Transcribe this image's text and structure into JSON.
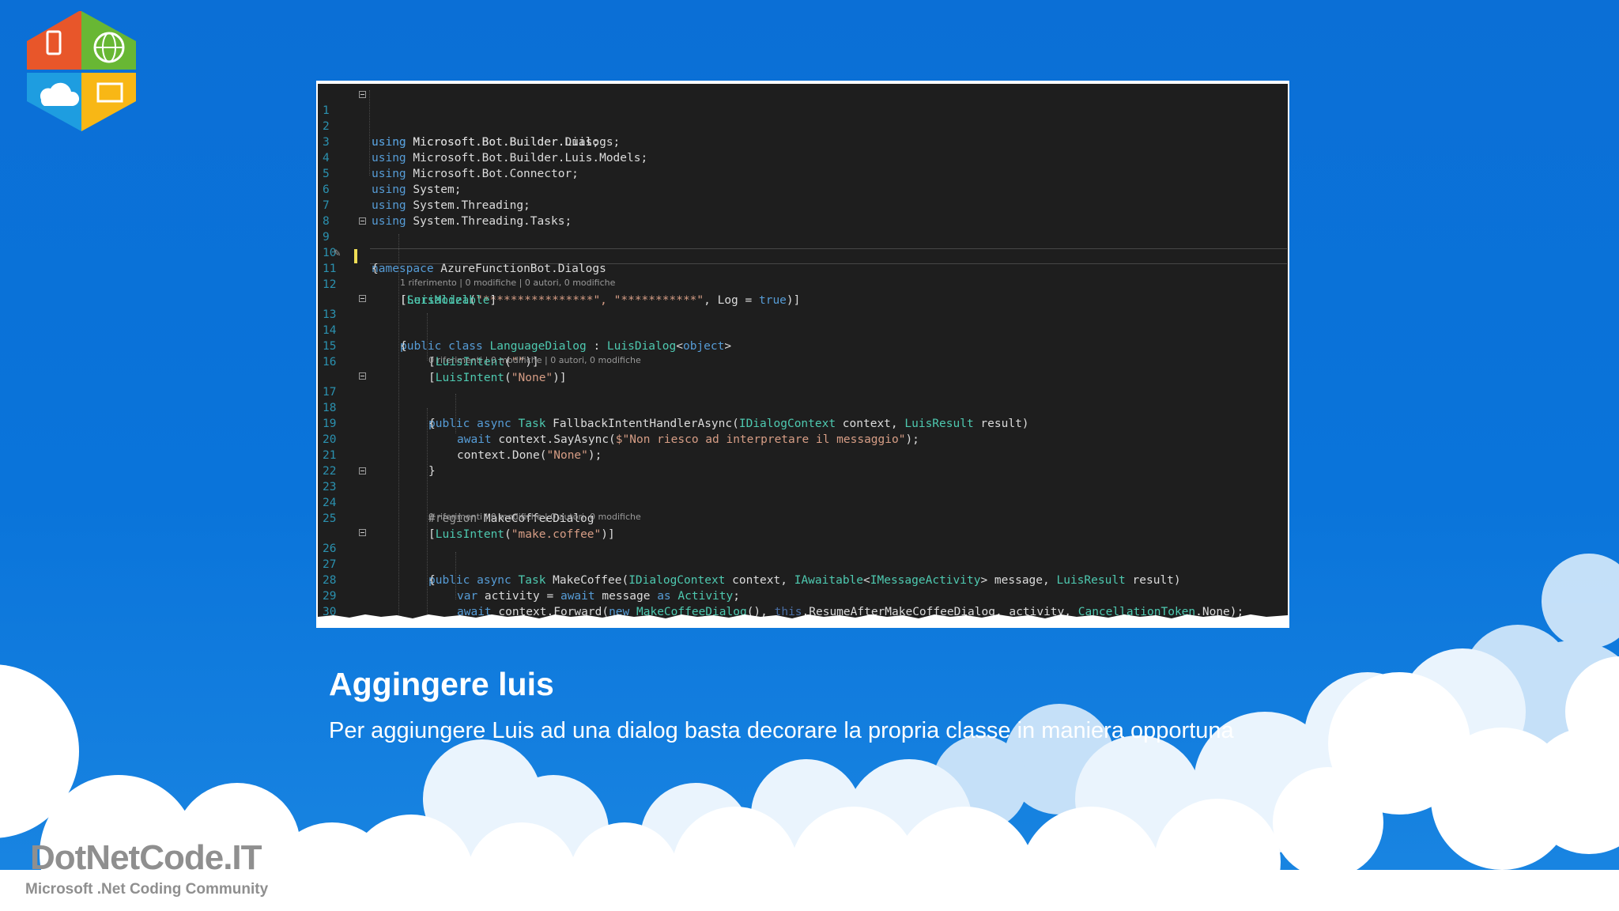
{
  "slide": {
    "title": "Aggingere luis",
    "subtitle": "Per aggiungere Luis ad una dialog basta decorare la propria classe in maniera opportuna"
  },
  "branding": {
    "name": "DotNetCode.IT",
    "tagline": "Microsoft .Net Coding Community",
    "logo_tiles": [
      "mobile-icon",
      "globe-icon",
      "cloud-icon",
      "desktop-icon"
    ],
    "logo_colors": [
      "#e8562a",
      "#68b734",
      "#1e9de0",
      "#f8b715"
    ]
  },
  "editor": {
    "colors": {
      "background": "#1e1e1e",
      "keyword": "#569cd6",
      "type": "#4ec9b0",
      "string": "#d69d85",
      "line_number": "#2b91af"
    },
    "lines": {
      "l1": {
        "num": "1",
        "a": "using",
        "b": " Microsoft.Bot.Builder.Dialogs;"
      },
      "l2": {
        "num": "2",
        "a": "using",
        "b": " Microsoft.Bot.Builder.Luis;"
      },
      "l3": {
        "num": "3",
        "a": "using",
        "b": " Microsoft.Bot.Builder.Luis.Models;"
      },
      "l4": {
        "num": "4",
        "a": "using",
        "b": " Microsoft.Bot.Connector;"
      },
      "l5": {
        "num": "5",
        "a": "using",
        "b": " System;"
      },
      "l6": {
        "num": "6",
        "a": "using",
        "b": " System.Threading;"
      },
      "l7": {
        "num": "7",
        "a": "using",
        "b": " System.Threading.Tasks;"
      },
      "l8": {
        "num": "8"
      },
      "l9": {
        "num": "9",
        "a": "namespace",
        "b": " AzureFunctionBot.Dialogs"
      },
      "l10": {
        "num": "10",
        "a": "{"
      },
      "l11": {
        "num": "11",
        "a": "[",
        "b": "LuisModel",
        "c": "(",
        "d": "\"****************\", \"***********\"",
        "e": ", Log = ",
        "f": "true",
        "g": ")]"
      },
      "l12": {
        "num": "12",
        "a": "[",
        "b": "Serializable",
        "c": "]"
      },
      "lens1": "1 riferimento | 0 modifiche | 0 autori, 0 modifiche",
      "l13": {
        "num": "13",
        "a": "public class ",
        "b": "LanguageDialog",
        "c": " : ",
        "d": "LuisDialog",
        "e": "<",
        "f": "object",
        "g": ">"
      },
      "l14": {
        "num": "14",
        "a": "{"
      },
      "l15": {
        "num": "15",
        "a": "[",
        "b": "LuisIntent",
        "c": "(",
        "d": "\"\"",
        "e": ")]"
      },
      "l16": {
        "num": "16",
        "a": "[",
        "b": "LuisIntent",
        "c": "(",
        "d": "\"None\"",
        "e": ")]"
      },
      "lens2": "0 riferimenti | 0 modifiche | 0 autori, 0 modifiche",
      "l17": {
        "num": "17",
        "a": "public async ",
        "b": "Task",
        "c": " FallbackIntentHandlerAsync(",
        "d": "IDialogContext",
        "e": " context, ",
        "f": "LuisResult",
        "g": " result)"
      },
      "l18": {
        "num": "18",
        "a": "{"
      },
      "l19": {
        "num": "19",
        "a": "await",
        "b": " context.SayAsync(",
        "c": "$\"Non riesco ad interpretare il messaggio\"",
        "d": ");"
      },
      "l20": {
        "num": "20",
        "a": "context.Done(",
        "b": "\"None\"",
        "c": ");"
      },
      "l21": {
        "num": "21",
        "a": "}"
      },
      "l22": {
        "num": "22"
      },
      "l23": {
        "num": "23",
        "a": "#region ",
        "b": "MakeCoffeeDialog"
      },
      "l24": {
        "num": "24"
      },
      "l25": {
        "num": "25",
        "a": "[",
        "b": "LuisIntent",
        "c": "(",
        "d": "\"make.coffee\"",
        "e": ")]"
      },
      "lens3": "0 riferimenti | 0 modifiche | 0 autori, 0 modifiche",
      "l26": {
        "num": "26",
        "a": "public async ",
        "b": "Task",
        "c": " MakeCoffee(",
        "d": "IDialogContext",
        "e": " context, ",
        "f": "IAwaitable",
        "g": "<",
        "h": "IMessageActivity",
        "i": "> message, ",
        "j": "LuisResult",
        "k": " result)"
      },
      "l27": {
        "num": "27",
        "a": "{"
      },
      "l28": {
        "num": "28",
        "a": "var",
        "b": " activity = ",
        "c": "await",
        "d": " message ",
        "e": "as",
        "f": " ",
        "g": "Activity",
        "h": ";"
      },
      "l29": {
        "num": "29",
        "a": "await",
        "b": " context.Forward(",
        "c": "new",
        "d": " ",
        "e": "MakeCoffeeDialog",
        "f": "(), ",
        "g": "this",
        "h": ".ResumeAfterMakeCoffeeDialog, activity, ",
        "i": "CancellationToken",
        "j": ".None);"
      },
      "l30": {
        "num": "30",
        "a": "}"
      }
    }
  }
}
